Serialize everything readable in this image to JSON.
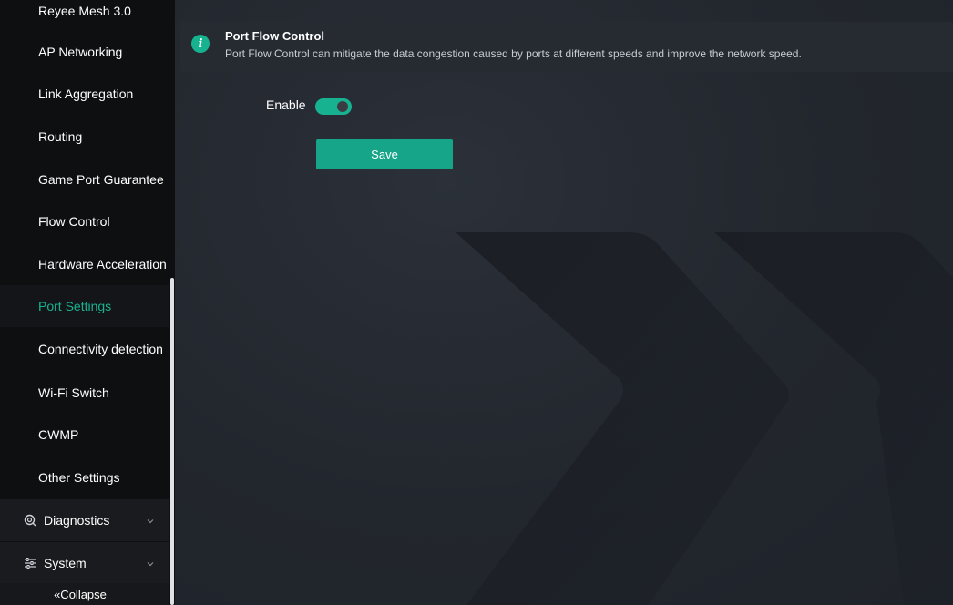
{
  "sidebar": {
    "items": [
      {
        "label": "Reyee Mesh 3.0"
      },
      {
        "label": "AP Networking"
      },
      {
        "label": "Link Aggregation"
      },
      {
        "label": "Routing"
      },
      {
        "label": "Game Port Guarantee"
      },
      {
        "label": "Flow Control"
      },
      {
        "label": "Hardware Acceleration"
      },
      {
        "label": "Port Settings",
        "active": true
      },
      {
        "label": "Connectivity detection"
      },
      {
        "label": "Wi-Fi Switch"
      },
      {
        "label": "CWMP"
      },
      {
        "label": "Other Settings"
      }
    ],
    "groups": [
      {
        "label": "Diagnostics",
        "icon": "diagnostics-icon"
      },
      {
        "label": "System",
        "icon": "system-icon"
      }
    ],
    "collapse_label": "«Collapse"
  },
  "info": {
    "title": "Port Flow Control",
    "description": "Port Flow Control can mitigate the data congestion caused by ports at different speeds and improve the network speed."
  },
  "form": {
    "enable_label": "Enable",
    "enabled": true,
    "save_label": "Save"
  },
  "colors": {
    "accent": "#17b391",
    "sidebar_bg": "#0e0f11",
    "main_bg": "#23262d"
  }
}
